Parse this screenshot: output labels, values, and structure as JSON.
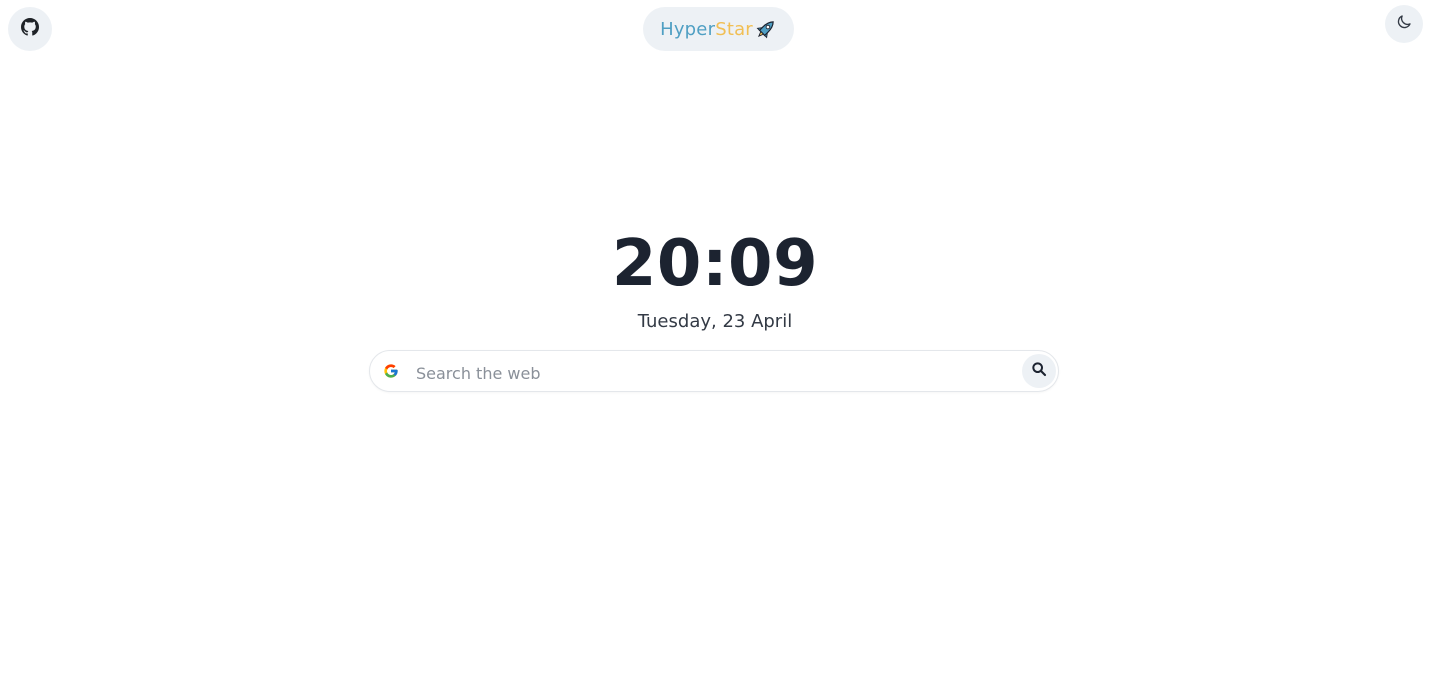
{
  "header": {
    "brand": {
      "part1": "Hyper",
      "part2": "Star",
      "rocket_icon": "rocket-icon"
    },
    "github_icon": "github-icon",
    "theme_toggle_icon": "moon-icon"
  },
  "main": {
    "time": "20:09",
    "date": "Tuesday, 23 April",
    "search": {
      "placeholder": "Search the web",
      "engine_icon": "google-icon",
      "submit_icon": "search-icon"
    }
  },
  "colors": {
    "brand_part1": "#4f9fc3",
    "brand_part2": "#f1bf54",
    "button_bg": "#edf1f5",
    "clock_text": "#1c2330"
  }
}
